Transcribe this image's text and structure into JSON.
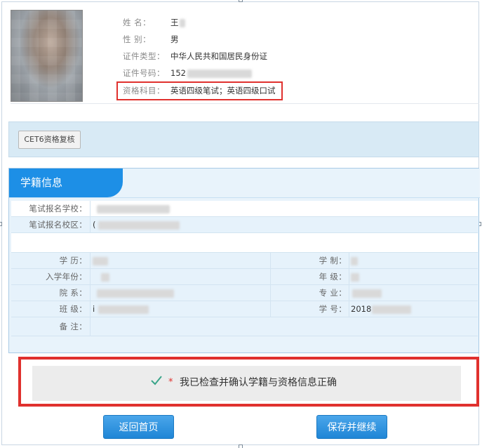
{
  "personal": {
    "name_label": "姓    名：",
    "name_value": "王",
    "gender_label": "性    别：",
    "gender_value": "男",
    "id_type_label": "证件类型：",
    "id_type_value": "中华人民共和国居民身份证",
    "id_number_label": "证件号码：",
    "id_number_value": "152",
    "subject_label": "资格科目：",
    "subject_value": "英语四级笔试；英语四级口试"
  },
  "cet6_button": "CET6资格复核",
  "xueji": {
    "title": "学籍信息",
    "school_label": "笔试报名学校：",
    "campus_label": "笔试报名校区：",
    "campus_value": "(",
    "education_label": "学    历：",
    "schooling_label": "学    制：",
    "enroll_year_label": "入学年份：",
    "grade_label": "年    级：",
    "department_label": "院    系：",
    "major_label": "专    业：",
    "class_label": "班    级：",
    "class_value": "i",
    "student_id_label": "学    号：",
    "student_id_value": "2018",
    "remark_label": "备    注："
  },
  "confirm": {
    "star": "*",
    "text": "我已检查并确认学籍与资格信息正确"
  },
  "buttons": {
    "back": "返回首页",
    "save": "保存并继续"
  },
  "colors": {
    "accent": "#1d8fe6",
    "highlight_red": "#e0312e",
    "check_green": "#3aa58a"
  }
}
